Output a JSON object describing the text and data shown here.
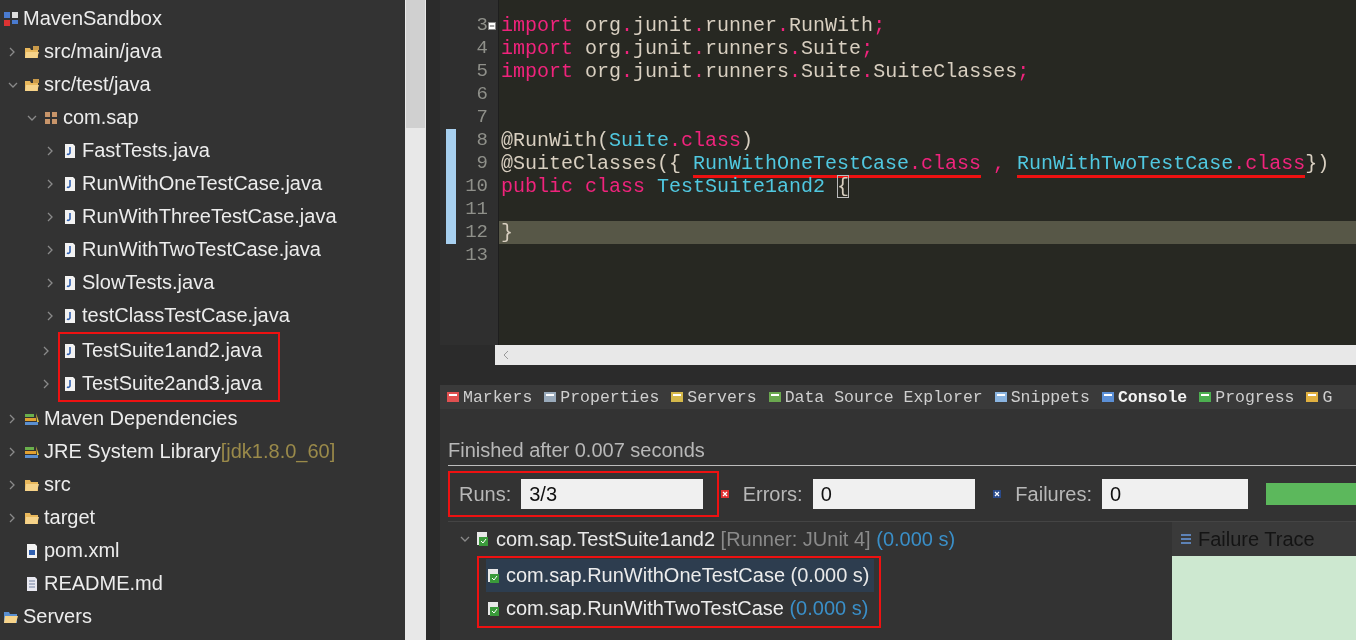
{
  "project_tree": {
    "items": [
      {
        "label": "MavenSandbox",
        "kind": "project",
        "highlighted": false,
        "children": [
          {
            "label": "src/main/java",
            "kind": "source-folder",
            "expanded": false,
            "highlighted": false
          },
          {
            "label": "src/test/java",
            "kind": "source-folder",
            "expanded": true,
            "highlighted": false,
            "children": [
              {
                "label": "com.sap",
                "kind": "package",
                "expanded": true,
                "highlighted": false,
                "children": [
                  {
                    "label": "FastTests.java",
                    "kind": "java-file",
                    "expanded": false,
                    "highlighted": false
                  },
                  {
                    "label": "RunWithOneTestCase.java",
                    "kind": "java-file",
                    "expanded": false,
                    "highlighted": false
                  },
                  {
                    "label": "RunWithThreeTestCase.java",
                    "kind": "java-file",
                    "expanded": false,
                    "highlighted": false
                  },
                  {
                    "label": "RunWithTwoTestCase.java",
                    "kind": "java-file",
                    "expanded": false,
                    "highlighted": false
                  },
                  {
                    "label": "SlowTests.java",
                    "kind": "java-file",
                    "expanded": false,
                    "highlighted": false
                  },
                  {
                    "label": "testClassTestCase.java",
                    "kind": "java-file",
                    "expanded": false,
                    "highlighted": false
                  },
                  {
                    "label": "TestSuite1and2.java",
                    "kind": "java-file",
                    "expanded": false,
                    "highlighted": true
                  },
                  {
                    "label": "TestSuite2and3.java",
                    "kind": "java-file",
                    "expanded": false,
                    "highlighted": true
                  }
                ]
              }
            ]
          },
          {
            "label": "Maven Dependencies",
            "kind": "library",
            "expanded": false,
            "highlighted": false
          },
          {
            "label": "JRE System Library",
            "decoration": "[jdk1.8.0_60]",
            "kind": "library",
            "expanded": false,
            "highlighted": false
          },
          {
            "label": "src",
            "kind": "folder",
            "expanded": false,
            "highlighted": false
          },
          {
            "label": "target",
            "kind": "folder",
            "expanded": false,
            "highlighted": false
          },
          {
            "label": "pom.xml",
            "kind": "xml-file",
            "highlighted": false
          },
          {
            "label": "README.md",
            "kind": "text-file",
            "highlighted": false
          }
        ]
      },
      {
        "label": "Servers",
        "kind": "open-folder",
        "highlighted": false
      }
    ]
  },
  "editor": {
    "lines": [
      {
        "number": "3",
        "current": false,
        "changed": false,
        "fold": true,
        "tokens": [
          {
            "kind": "keyword",
            "text": "import",
            "underlined": false
          },
          {
            "kind": "plain",
            "text": " org",
            "underlined": false
          },
          {
            "kind": "keyword",
            "text": ".",
            "underlined": false
          },
          {
            "kind": "plain",
            "text": "junit",
            "underlined": false
          },
          {
            "kind": "keyword",
            "text": ".",
            "underlined": false
          },
          {
            "kind": "plain",
            "text": "runner",
            "underlined": false
          },
          {
            "kind": "keyword",
            "text": ".",
            "underlined": false
          },
          {
            "kind": "plain",
            "text": "RunWith",
            "underlined": false
          },
          {
            "kind": "keyword",
            "text": ";",
            "underlined": false
          }
        ]
      },
      {
        "number": "4",
        "current": false,
        "changed": false,
        "fold": false,
        "tokens": [
          {
            "kind": "keyword",
            "text": "import",
            "underlined": false
          },
          {
            "kind": "plain",
            "text": " org",
            "underlined": false
          },
          {
            "kind": "keyword",
            "text": ".",
            "underlined": false
          },
          {
            "kind": "plain",
            "text": "junit",
            "underlined": false
          },
          {
            "kind": "keyword",
            "text": ".",
            "underlined": false
          },
          {
            "kind": "plain",
            "text": "runners",
            "underlined": false
          },
          {
            "kind": "keyword",
            "text": ".",
            "underlined": false
          },
          {
            "kind": "plain",
            "text": "Suite",
            "underlined": false
          },
          {
            "kind": "keyword",
            "text": ";",
            "underlined": false
          }
        ]
      },
      {
        "number": "5",
        "current": false,
        "changed": false,
        "fold": false,
        "tokens": [
          {
            "kind": "keyword",
            "text": "import",
            "underlined": false
          },
          {
            "kind": "plain",
            "text": " org",
            "underlined": false
          },
          {
            "kind": "keyword",
            "text": ".",
            "underlined": false
          },
          {
            "kind": "plain",
            "text": "junit",
            "underlined": false
          },
          {
            "kind": "keyword",
            "text": ".",
            "underlined": false
          },
          {
            "kind": "plain",
            "text": "runners",
            "underlined": false
          },
          {
            "kind": "keyword",
            "text": ".",
            "underlined": false
          },
          {
            "kind": "plain",
            "text": "Suite",
            "underlined": false
          },
          {
            "kind": "keyword",
            "text": ".",
            "underlined": false
          },
          {
            "kind": "plain",
            "text": "SuiteClasses",
            "underlined": false
          },
          {
            "kind": "keyword",
            "text": ";",
            "underlined": false
          }
        ]
      },
      {
        "number": "6",
        "current": false,
        "changed": false,
        "fold": false
      },
      {
        "number": "7",
        "current": false,
        "changed": false,
        "fold": false
      },
      {
        "number": "8",
        "current": false,
        "changed": true,
        "fold": false,
        "tokens": [
          {
            "kind": "plain",
            "text": "@RunWith(",
            "underlined": false
          },
          {
            "kind": "type",
            "text": "Suite",
            "underlined": false
          },
          {
            "kind": "keyword",
            "text": ".class",
            "underlined": false
          },
          {
            "kind": "plain",
            "text": ")",
            "underlined": false
          }
        ]
      },
      {
        "number": "9",
        "current": false,
        "changed": true,
        "fold": false,
        "tokens": [
          {
            "kind": "plain",
            "text": "@SuiteClasses({ ",
            "underlined": false
          },
          {
            "kind": "type",
            "text": "RunWithOneTestCase",
            "underlined": true
          },
          {
            "kind": "keyword",
            "text": ".class",
            "underlined": true
          },
          {
            "kind": "keyword",
            "text": " , ",
            "underlined": false
          },
          {
            "kind": "type",
            "text": "RunWithTwoTestCase",
            "underlined": true
          },
          {
            "kind": "keyword",
            "text": ".class",
            "underlined": true
          },
          {
            "kind": "plain",
            "text": "})",
            "underlined": false
          }
        ]
      },
      {
        "number": "10",
        "current": false,
        "changed": true,
        "fold": false,
        "tokens": [
          {
            "kind": "keyword",
            "text": "public",
            "underlined": false
          },
          {
            "kind": "keyword",
            "text": " class",
            "underlined": false
          },
          {
            "kind": "type",
            "text": " TestSuite1and2 ",
            "underlined": false
          },
          {
            "kind": "bracket-match",
            "text": "{",
            "underlined": false
          }
        ]
      },
      {
        "number": "11",
        "current": false,
        "changed": true,
        "fold": false
      },
      {
        "number": "12",
        "current": true,
        "changed": true,
        "fold": false,
        "tokens": [
          {
            "kind": "plain",
            "text": "}",
            "underlined": false
          }
        ]
      },
      {
        "number": "13",
        "current": false,
        "changed": false,
        "fold": false
      }
    ]
  },
  "view_tabs": [
    {
      "label": "Markers",
      "kind": "markers",
      "selected": false
    },
    {
      "label": "Properties",
      "kind": "properties",
      "selected": false
    },
    {
      "label": "Servers",
      "kind": "servers",
      "selected": false
    },
    {
      "label": "Data Source Explorer",
      "kind": "data-source",
      "selected": false
    },
    {
      "label": "Snippets",
      "kind": "snippets",
      "selected": false
    },
    {
      "label": "Console",
      "kind": "console",
      "selected": true
    },
    {
      "label": "Progress",
      "kind": "progress",
      "selected": false
    },
    {
      "label": "G",
      "kind": "git",
      "selected": false
    }
  ],
  "junit": {
    "status": "Finished after 0.007 seconds",
    "counters": [
      {
        "kind": "runs",
        "label": "Runs:",
        "value": "3/3",
        "highlighted": true
      },
      {
        "kind": "errors",
        "label": "Errors:",
        "value": "0",
        "highlighted": false
      },
      {
        "kind": "failures",
        "label": "Failures:",
        "value": "0",
        "highlighted": false
      }
    ],
    "progress": {
      "level": 1
    },
    "tests": {
      "label": "com.sap.TestSuite1and2",
      "runner": "[Runner: JUnit 4]",
      "time": "(0.000 s)",
      "children": [
        {
          "label": "com.sap.RunWithOneTestCase",
          "time": "(0.000 s)",
          "selected": true,
          "highlighted": true
        },
        {
          "label": "com.sap.RunWithTwoTestCase",
          "time": "(0.000 s)",
          "selected": false,
          "highlighted": true
        }
      ]
    },
    "failure_trace": {
      "title": "Failure Trace"
    }
  }
}
